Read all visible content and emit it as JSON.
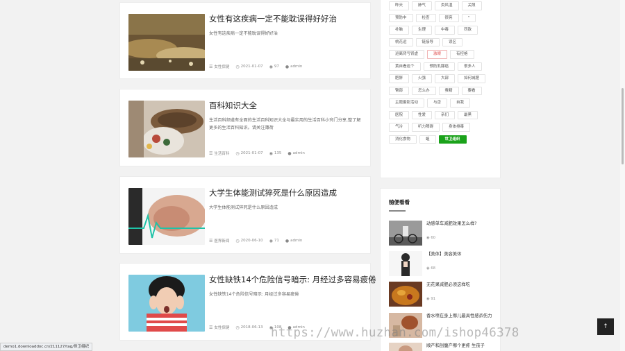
{
  "articles": [
    {
      "title": "女性有这疾病一定不能耽误得好好治",
      "excerpt": "女性有这疾病一定不能耽误得好好治",
      "category": "女性保健",
      "date": "2021-01-07",
      "views": "97",
      "author": "admin"
    },
    {
      "title": "百科知识大全",
      "excerpt": "生活百科频道有全面的生活百科知识大全与最实用的生活百科小窍门分享,整了解更多的生活百科知识。请关注薄荷",
      "category": "生活百科",
      "date": "2021-01-07",
      "views": "135",
      "author": "admin"
    },
    {
      "title": "大学生体能测试猝死是什么原因造成",
      "excerpt": "大学生体能测试猝死是什么原因造成",
      "category": "医界新闻",
      "date": "2020-06-10",
      "views": "71",
      "author": "admin"
    },
    {
      "title": "女性缺铁14个危险信号暗示: 月经过多容易疲倦",
      "excerpt": "女性缺铁14个危险信号暗示: 月经过多容易疲倦",
      "category": "女性保健",
      "date": "2018-06-13",
      "views": "108",
      "author": "admin"
    }
  ],
  "tags": [
    "昨天",
    "肺气",
    "类风湿",
    "关照",
    "预防中",
    "检查",
    "很亮",
    "\"",
    "补脑",
    "生理",
    "中毒",
    "罚款",
    "桃花运",
    "链接导",
    "误区",
    "运离肾亏肾虚",
    "激眼",
    "有控格",
    "黄自看这个",
    "预防乳腺癌",
    "很多人",
    "肥胖",
    "火强",
    "大部",
    "如何减肥",
    "臀部",
    "怎么办",
    "蚕精",
    "要看",
    "主题摄影活动",
    "与否",
    "自我",
    "医院",
    "性爱",
    "亲们",
    "最黑",
    "气冷",
    "听力障碍",
    "身体排毒",
    "消化食物",
    "蛆",
    "世卫组织"
  ],
  "random_panel": {
    "title": "随便看看",
    "items": [
      {
        "title": "动感单车减肥效果怎么样?",
        "views": "60"
      },
      {
        "title": "【美体】美容美体",
        "views": "68"
      },
      {
        "title": "无花果减肥必须这样吃",
        "views": "91"
      },
      {
        "title": "香水喷在身上哪儿最具性感杀伤力",
        "views": ""
      },
      {
        "title": "顺产和剖腹产哪个更疼 生孩子",
        "views": ""
      }
    ]
  },
  "back_to_top": "↑",
  "status_url": "demo1.downloaddoc.cn/211127/tag/世卫组织",
  "watermark": "https://www.huzhan.com/ishop46378",
  "icons": {
    "category": "list-icon",
    "date": "clock-icon",
    "views": "eye-icon",
    "author": "user-icon"
  },
  "colors": {
    "active_tag": "#1aa21a",
    "hot_tag": "#e05050"
  }
}
